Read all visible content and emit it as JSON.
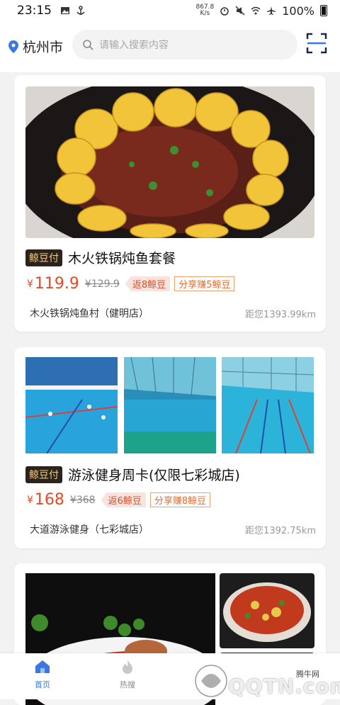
{
  "status_bar": {
    "time": "23:15",
    "net_speed": "867.8\nK/s",
    "battery": "100%"
  },
  "header": {
    "city": "杭州市",
    "search_placeholder": "请输入搜索内容"
  },
  "colors": {
    "price_red": "#e34a26",
    "tab_active": "#3a78e0",
    "badge_bg": "#2b241c"
  },
  "cards": [
    {
      "badge": "鲸豆付",
      "title": "木火铁锅炖鱼套餐",
      "currency": "¥",
      "price": "119.9",
      "original_price": "¥129.9",
      "rebate": "返8鲸豆",
      "share": "分享赚5鲸豆",
      "shop": "木火铁锅炖鱼村（健明店）",
      "distance": "距您1393.99km"
    },
    {
      "badge": "鲸豆付",
      "title": "游泳健身周卡(仅限七彩城店)",
      "currency": "¥",
      "price": "168",
      "original_price": "¥368",
      "rebate": "返6鲸豆",
      "share": "分享赚8鲸豆",
      "shop": "大道游泳健身（七彩城店）",
      "distance": "距您1392.75km"
    }
  ],
  "tabbar": {
    "tabs": [
      {
        "label": "首页",
        "icon": "home-icon"
      },
      {
        "label": "热搜",
        "icon": "flame-icon"
      }
    ]
  },
  "watermark": {
    "small": "腾牛网",
    "main": "QQTN.com"
  }
}
